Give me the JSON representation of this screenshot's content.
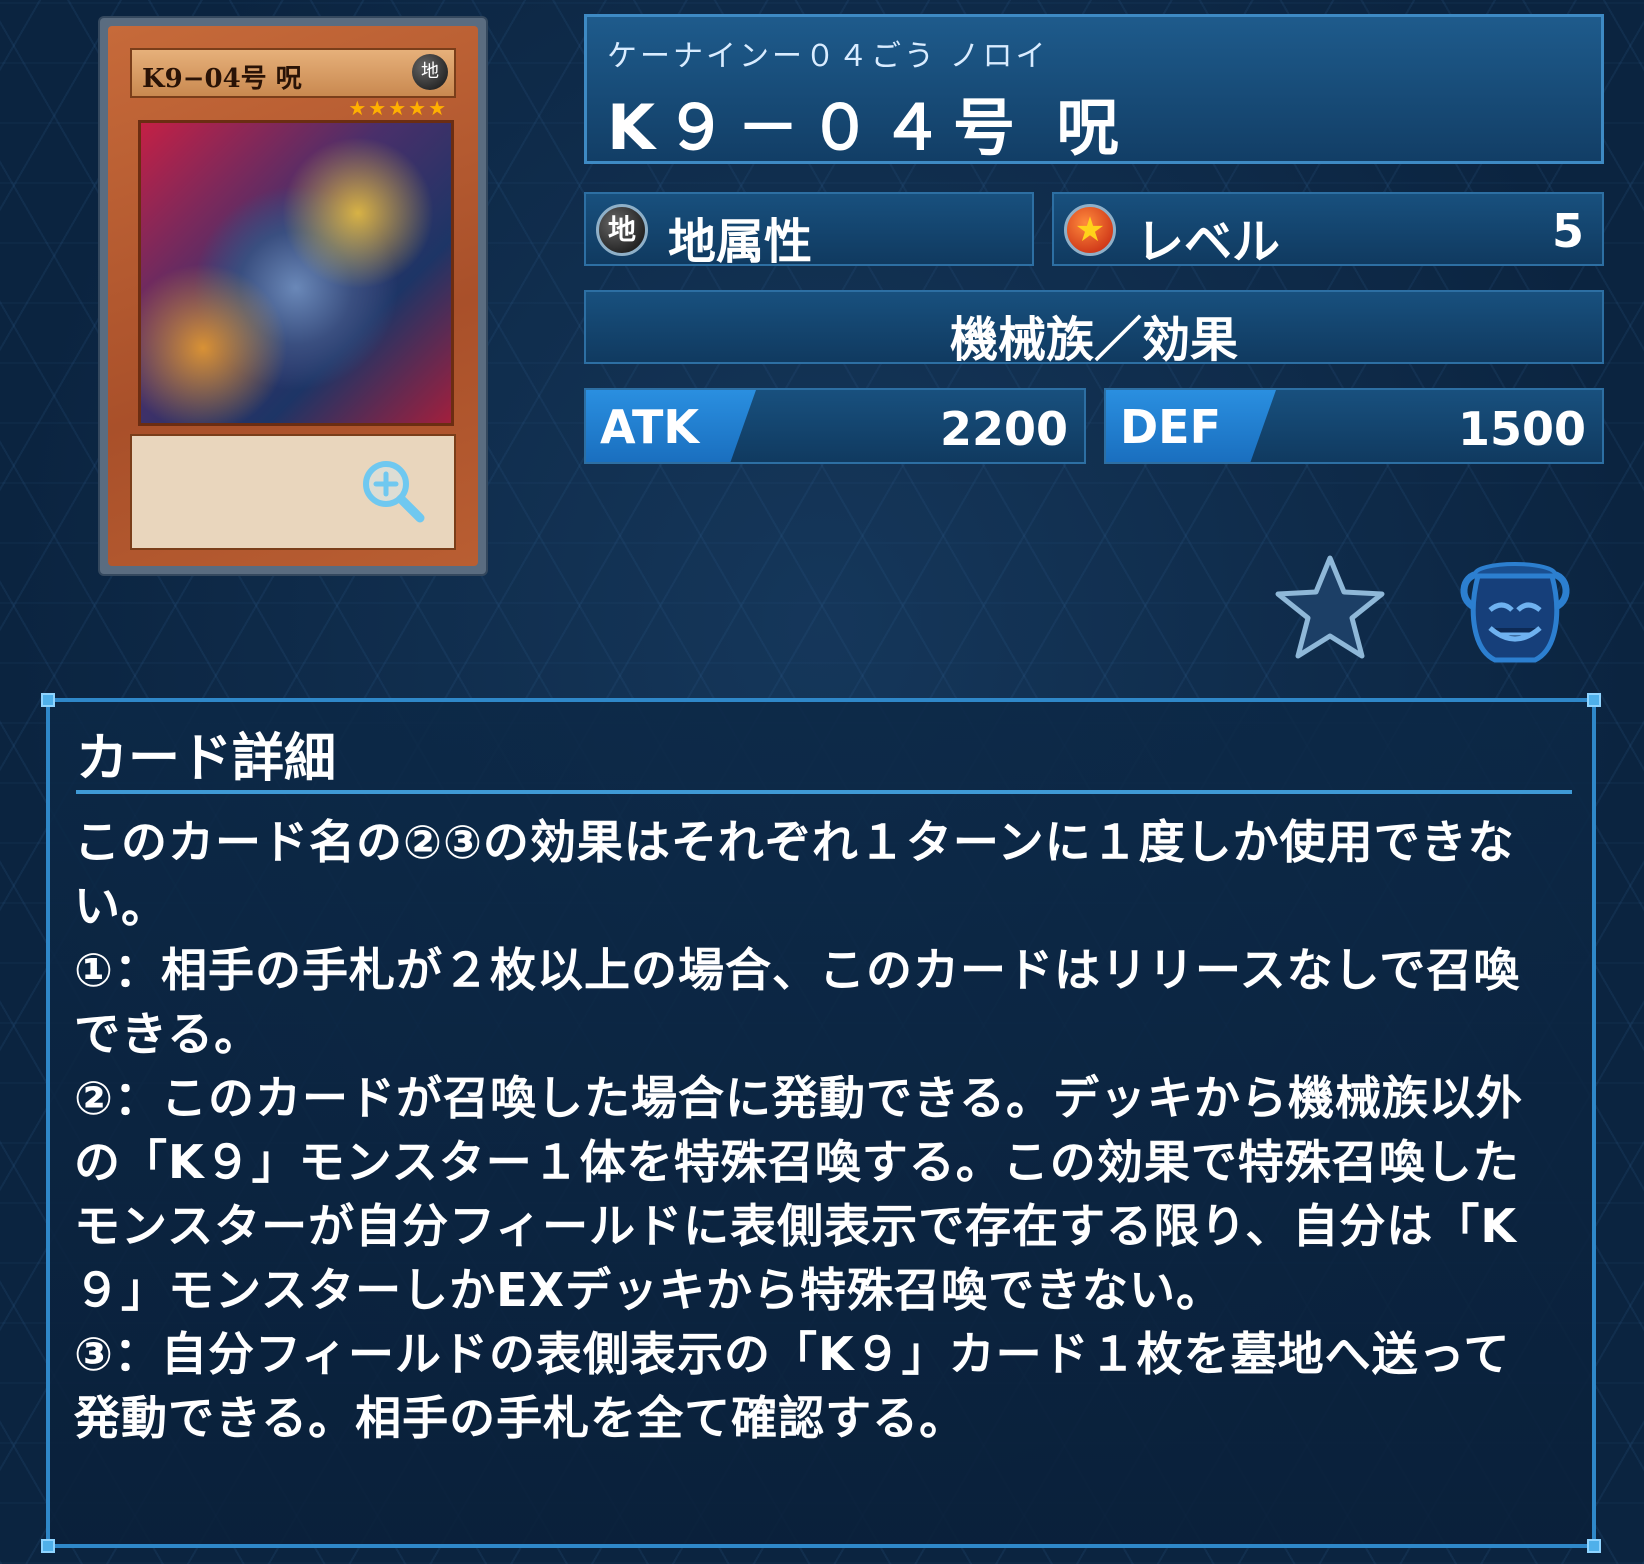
{
  "card_image": {
    "name_label": "K9−04号 呪",
    "attribute_glyph": "地",
    "level_stars": "★★★★★"
  },
  "header": {
    "reading": "ケーナインー０４ごう ノロイ",
    "name": "K９－０４号 呪"
  },
  "stats": {
    "attribute_icon": "地",
    "attribute": "地属性",
    "level_label": "レベル",
    "level": "5",
    "type": "機械族／効果",
    "atk_label": "ATK",
    "atk": "2200",
    "def_label": "DEF",
    "def": "1500"
  },
  "icons": {
    "zoom": "zoom-in-icon",
    "favorite": "star-icon",
    "pot": "pot-of-greed-icon"
  },
  "colors": {
    "accent": "#2f88c9",
    "background": "#0b2440"
  },
  "detail": {
    "title": "カード詳細",
    "lines": [
      "このカード名の②③の効果はそれぞれ１ターンに１度しか使用できない。",
      "①：相手の手札が２枚以上の場合、このカードはリリースなしで召喚できる。",
      "②：このカードが召喚した場合に発動できる。デッキから機械族以外の「K９」モンスター１体を特殊召喚する。この効果で特殊召喚したモンスターが自分フィールドに表側表示で存在する限り、自分は「K９」モンスターしかEXデッキから特殊召喚できない。",
      "③：自分フィールドの表側表示の「K９」カード１枚を墓地へ送って発動できる。相手の手札を全て確認する。"
    ]
  }
}
